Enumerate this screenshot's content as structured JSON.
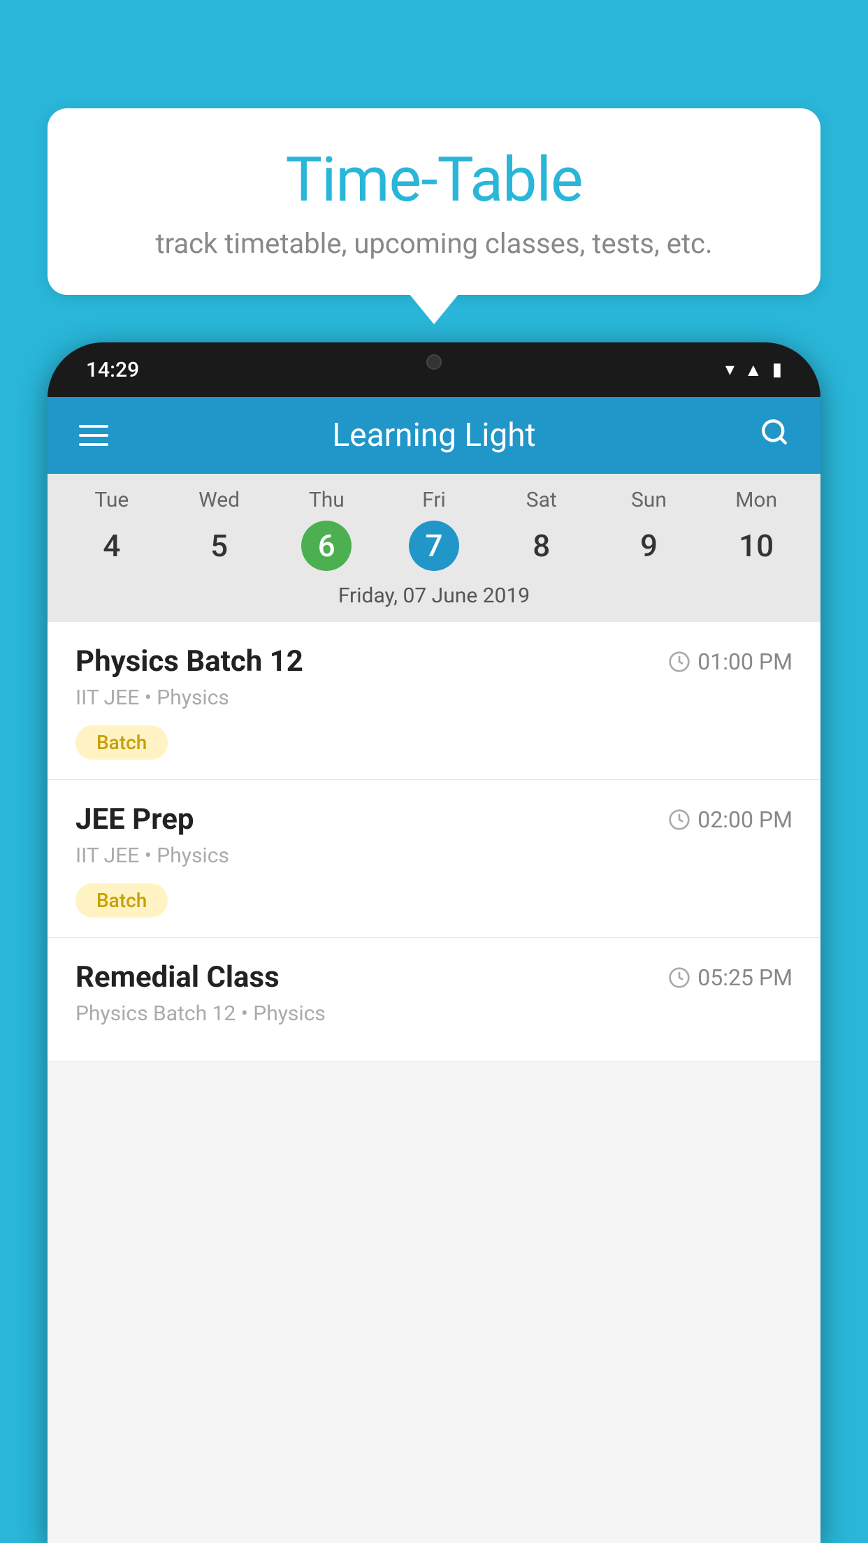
{
  "background_color": "#29B6D8",
  "speech_bubble": {
    "title": "Time-Table",
    "subtitle": "track timetable, upcoming classes, tests, etc."
  },
  "phone": {
    "status_bar": {
      "time": "14:29"
    },
    "app_header": {
      "title": "Learning Light"
    },
    "calendar": {
      "days": [
        {
          "name": "Tue",
          "number": "4",
          "state": "normal"
        },
        {
          "name": "Wed",
          "number": "5",
          "state": "normal"
        },
        {
          "name": "Thu",
          "number": "6",
          "state": "today"
        },
        {
          "name": "Fri",
          "number": "7",
          "state": "selected"
        },
        {
          "name": "Sat",
          "number": "8",
          "state": "normal"
        },
        {
          "name": "Sun",
          "number": "9",
          "state": "normal"
        },
        {
          "name": "Mon",
          "number": "10",
          "state": "normal"
        }
      ],
      "selected_date_label": "Friday, 07 June 2019"
    },
    "schedule": [
      {
        "title": "Physics Batch 12",
        "time": "01:00 PM",
        "subtitle": "IIT JEE • Physics",
        "badge": "Batch"
      },
      {
        "title": "JEE Prep",
        "time": "02:00 PM",
        "subtitle": "IIT JEE • Physics",
        "badge": "Batch"
      },
      {
        "title": "Remedial Class",
        "time": "05:25 PM",
        "subtitle": "Physics Batch 12 • Physics",
        "badge": null
      }
    ]
  }
}
